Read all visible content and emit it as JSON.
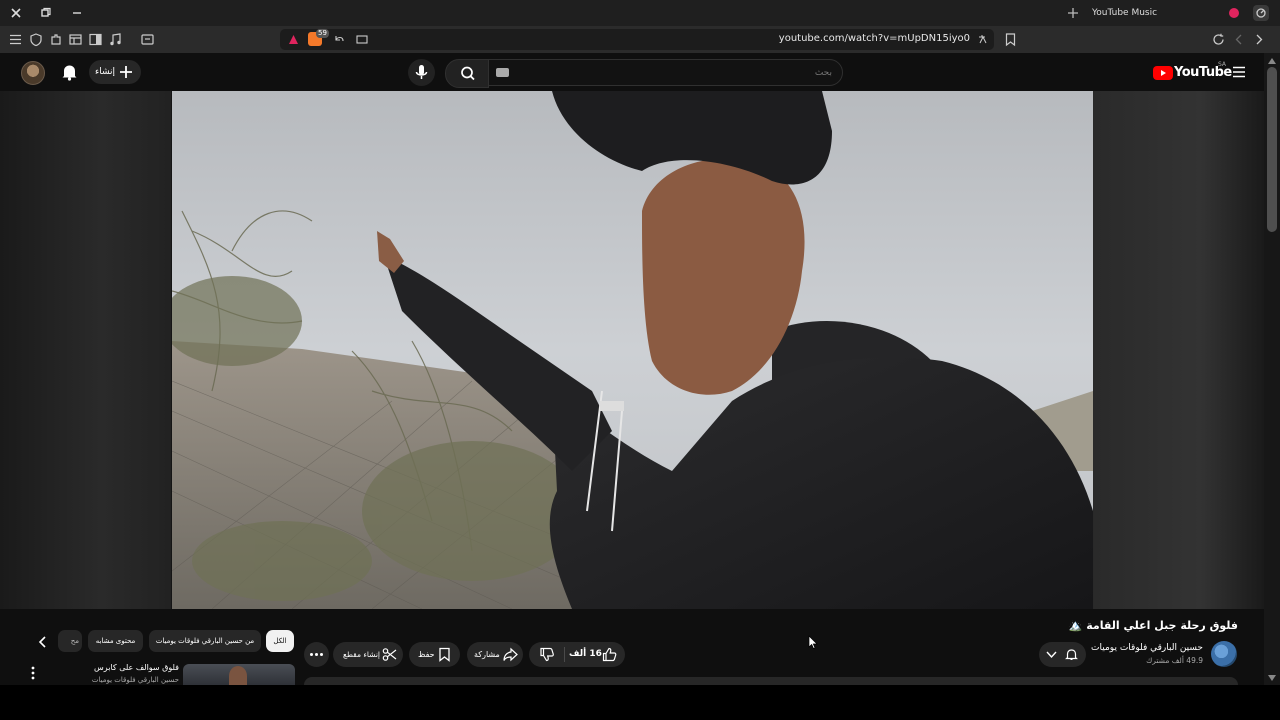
{
  "browser": {
    "tab_title": "YouTube Music",
    "url": "youtube.com/watch?v=mUpDN15iyo0",
    "badge": "59"
  },
  "youtube": {
    "logo_text": "YouTube",
    "region": "SA",
    "search_placeholder": "بحث",
    "create_label": "إنشاء"
  },
  "video": {
    "title": "فلوق رحلة جبل اعلي القامة 🏔️",
    "channel_name": "حسين البارقي فلوقات يوميات",
    "subscribers": "49.9 ألف مشترك",
    "likes": "16 ألف",
    "share_label": "مشاركة",
    "save_label": "حفظ",
    "clip_label": "إنشاء مقطع"
  },
  "chips": [
    "الكل",
    "من حسين البارقي فلوقات يوميات",
    "محتوى مشابه",
    "مح"
  ],
  "recommendation": {
    "title": "فلوق سوالف على كابرس",
    "subtitle": "حسين البارقي فلوقات يوميات"
  },
  "colors": {
    "yt_red": "#ff0000",
    "bg": "#0f0f0f",
    "chrome": "#1f1f1f",
    "toolbar": "#2b2b2b"
  }
}
